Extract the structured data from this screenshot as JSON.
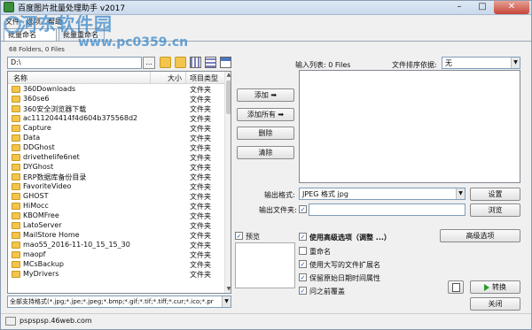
{
  "window": {
    "title": "百度图片批量处理助手  v2017",
    "close_label": "✕",
    "min_label": "–",
    "max_label": "□"
  },
  "menu": {
    "items": [
      "文件",
      "选项",
      "帮助"
    ]
  },
  "watermark": {
    "title": "河东软件园",
    "url": "www.pc0359.cn"
  },
  "tabs": [
    "批量命名",
    "批量重命名"
  ],
  "left": {
    "folders_count": "68 Folders, 0 Files",
    "path": "D:\\",
    "browse_label": "...",
    "columns": {
      "name": "名称",
      "size": "大小",
      "type": "项目类型"
    },
    "rows": [
      {
        "name": "360Downloads",
        "type": "文件夹"
      },
      {
        "name": "360se6",
        "type": "文件夹"
      },
      {
        "name": "360安全浏览器下载",
        "type": "文件夹"
      },
      {
        "name": "ac111204414f4d604b375568d2",
        "type": "文件夹"
      },
      {
        "name": "Capture",
        "type": "文件夹"
      },
      {
        "name": "Data",
        "type": "文件夹"
      },
      {
        "name": "DDGhost",
        "type": "文件夹"
      },
      {
        "name": "drivethelife6net",
        "type": "文件夹"
      },
      {
        "name": "DYGhost",
        "type": "文件夹"
      },
      {
        "name": "ERP数据库备份目录",
        "type": "文件夹"
      },
      {
        "name": "FavoriteVideo",
        "type": "文件夹"
      },
      {
        "name": "GHOST",
        "type": "文件夹"
      },
      {
        "name": "HiMocc",
        "type": "文件夹"
      },
      {
        "name": "KBOMFree",
        "type": "文件夹"
      },
      {
        "name": "LatoServer",
        "type": "文件夹"
      },
      {
        "name": "MailStore Home",
        "type": "文件夹"
      },
      {
        "name": "mao55_2016-11-10_15_15_30",
        "type": "文件夹"
      },
      {
        "name": "maopf",
        "type": "文件夹"
      },
      {
        "name": "MCsBackup",
        "type": "文件夹"
      },
      {
        "name": "MyDrivers",
        "type": "文件夹"
      }
    ],
    "filter": "全部支持格式(*.jpg;*.jpe;*.jpeg;*.bmp;*.gif;*.tif;*.tiff;*.cur;*.ico;*.pr"
  },
  "middle": {
    "add": "添加 ➡",
    "add_all": "添加所有 ➡",
    "delete": "删除",
    "clear": "清除"
  },
  "right": {
    "input_list_label": "输入列表: 0 Files",
    "sort_label": "文件排序依据:",
    "sort_value": "无",
    "output_format_label": "输出格式:",
    "output_format_value": "JPEG 格式 jpg",
    "settings": "设置",
    "output_folder_label": "输出文件夹:",
    "browse": "浏览",
    "preview_label": "预览",
    "use_advanced": "使用高级选项（调整 ...）",
    "advanced_button": "高级选项",
    "rename": "重命名",
    "uppercase_ext": "使用大写的文件扩展名",
    "keep_date": "保留原始日期时间属性",
    "overwrite": "问之前覆盖",
    "convert": "转换",
    "close": "关闭"
  },
  "status": {
    "text": "pspspsp.46web.com"
  }
}
